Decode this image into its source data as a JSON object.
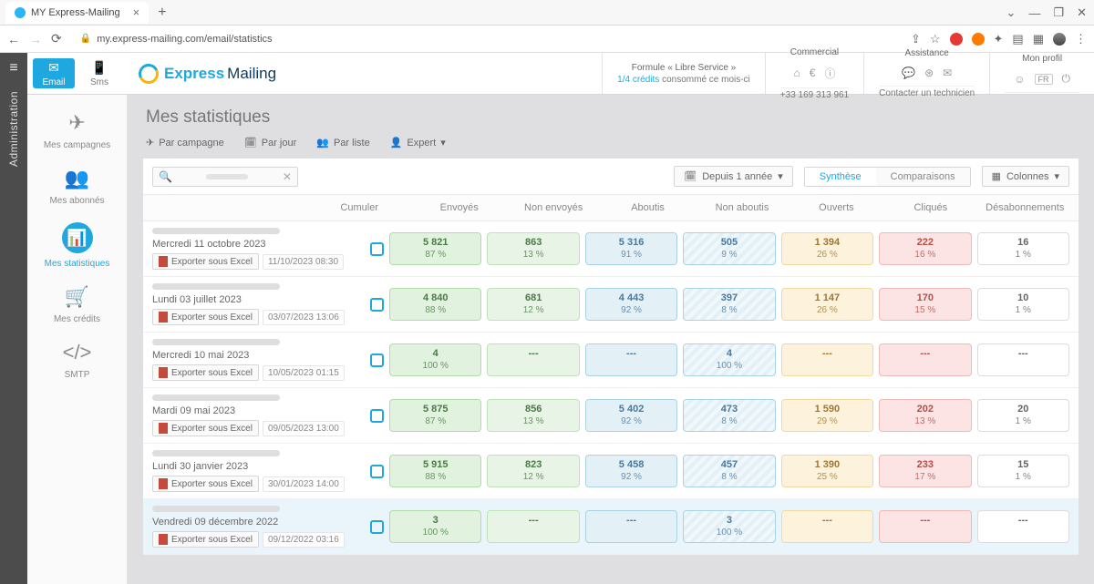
{
  "browser": {
    "tab_title": "MY Express-Mailing",
    "url": "my.express-mailing.com/email/statistics"
  },
  "header": {
    "channels": {
      "email": "Email",
      "sms": "Sms"
    },
    "logo_p1": "Express",
    "logo_p2": "Mailing",
    "cols": {
      "formule": {
        "hd": "Formule « Libre Service »",
        "credits": "1/4 crédits",
        "sub": "consommé ce mois-ci"
      },
      "commercial": {
        "hd": "Commercial",
        "phone": "+33 169 313 961"
      },
      "assistance": {
        "hd": "Assistance",
        "link": "Contacter un technicien"
      },
      "profil": {
        "hd": "Mon profil",
        "lang": "FR"
      }
    }
  },
  "sidebar": {
    "admin": "Administration",
    "items": [
      {
        "label": "Mes campagnes",
        "icon": "✈"
      },
      {
        "label": "Mes abonnés",
        "icon": "👥"
      },
      {
        "label": "Mes statistiques",
        "icon": "⏱"
      },
      {
        "label": "Mes crédits",
        "icon": "🛒"
      },
      {
        "label": "SMTP",
        "icon": "</>"
      }
    ]
  },
  "page": {
    "title": "Mes statistiques",
    "filters": {
      "campagne": "Par campagne",
      "jour": "Par jour",
      "liste": "Par liste",
      "expert": "Expert"
    },
    "search_clear": "✕",
    "date_range": "Depuis 1 année",
    "tabs": {
      "synthese": "Synthèse",
      "comparaisons": "Comparaisons"
    },
    "columns_btn": "Colonnes"
  },
  "table": {
    "headers": {
      "cumuler": "Cumuler",
      "envoyes": "Envoyés",
      "non_envoyes": "Non envoyés",
      "aboutis": "Aboutis",
      "non_aboutis": "Non aboutis",
      "ouverts": "Ouverts",
      "cliques": "Cliqués",
      "desabo": "Désabonnements"
    },
    "export_label": "Exporter sous Excel",
    "rows": [
      {
        "date": "Mercredi 11 octobre 2023",
        "ts": "11/10/2023 08:30",
        "envoyes": {
          "n": "5 821",
          "p": "87 %"
        },
        "non_envoyes": {
          "n": "863",
          "p": "13 %"
        },
        "aboutis": {
          "n": "5 316",
          "p": "91 %"
        },
        "non_aboutis": {
          "n": "505",
          "p": "9 %"
        },
        "ouverts": {
          "n": "1 394",
          "p": "26 %"
        },
        "cliques": {
          "n": "222",
          "p": "16 %"
        },
        "desabo": {
          "n": "16",
          "p": "1 %"
        }
      },
      {
        "date": "Lundi 03 juillet 2023",
        "ts": "03/07/2023 13:06",
        "envoyes": {
          "n": "4 840",
          "p": "88 %"
        },
        "non_envoyes": {
          "n": "681",
          "p": "12 %"
        },
        "aboutis": {
          "n": "4 443",
          "p": "92 %"
        },
        "non_aboutis": {
          "n": "397",
          "p": "8 %"
        },
        "ouverts": {
          "n": "1 147",
          "p": "26 %"
        },
        "cliques": {
          "n": "170",
          "p": "15 %"
        },
        "desabo": {
          "n": "10",
          "p": "1 %"
        }
      },
      {
        "date": "Mercredi 10 mai 2023",
        "ts": "10/05/2023 01:15",
        "envoyes": {
          "n": "4",
          "p": "100 %"
        },
        "non_envoyes": {
          "n": "---",
          "p": ""
        },
        "aboutis": {
          "n": "---",
          "p": ""
        },
        "non_aboutis": {
          "n": "4",
          "p": "100 %"
        },
        "ouverts": {
          "n": "---",
          "p": ""
        },
        "cliques": {
          "n": "---",
          "p": ""
        },
        "desabo": {
          "n": "---",
          "p": ""
        }
      },
      {
        "date": "Mardi 09 mai 2023",
        "ts": "09/05/2023 13:00",
        "envoyes": {
          "n": "5 875",
          "p": "87 %"
        },
        "non_envoyes": {
          "n": "856",
          "p": "13 %"
        },
        "aboutis": {
          "n": "5 402",
          "p": "92 %"
        },
        "non_aboutis": {
          "n": "473",
          "p": "8 %"
        },
        "ouverts": {
          "n": "1 590",
          "p": "29 %"
        },
        "cliques": {
          "n": "202",
          "p": "13 %"
        },
        "desabo": {
          "n": "20",
          "p": "1 %"
        }
      },
      {
        "date": "Lundi 30 janvier 2023",
        "ts": "30/01/2023 14:00",
        "envoyes": {
          "n": "5 915",
          "p": "88 %"
        },
        "non_envoyes": {
          "n": "823",
          "p": "12 %"
        },
        "aboutis": {
          "n": "5 458",
          "p": "92 %"
        },
        "non_aboutis": {
          "n": "457",
          "p": "8 %"
        },
        "ouverts": {
          "n": "1 390",
          "p": "25 %"
        },
        "cliques": {
          "n": "233",
          "p": "17 %"
        },
        "desabo": {
          "n": "15",
          "p": "1 %"
        }
      },
      {
        "date": "Vendredi 09 décembre 2022",
        "ts": "09/12/2022 03:16",
        "envoyes": {
          "n": "3",
          "p": "100 %"
        },
        "non_envoyes": {
          "n": "---",
          "p": ""
        },
        "aboutis": {
          "n": "---",
          "p": ""
        },
        "non_aboutis": {
          "n": "3",
          "p": "100 %"
        },
        "ouverts": {
          "n": "---",
          "p": ""
        },
        "cliques": {
          "n": "---",
          "p": ""
        },
        "desabo": {
          "n": "---",
          "p": ""
        }
      }
    ]
  }
}
